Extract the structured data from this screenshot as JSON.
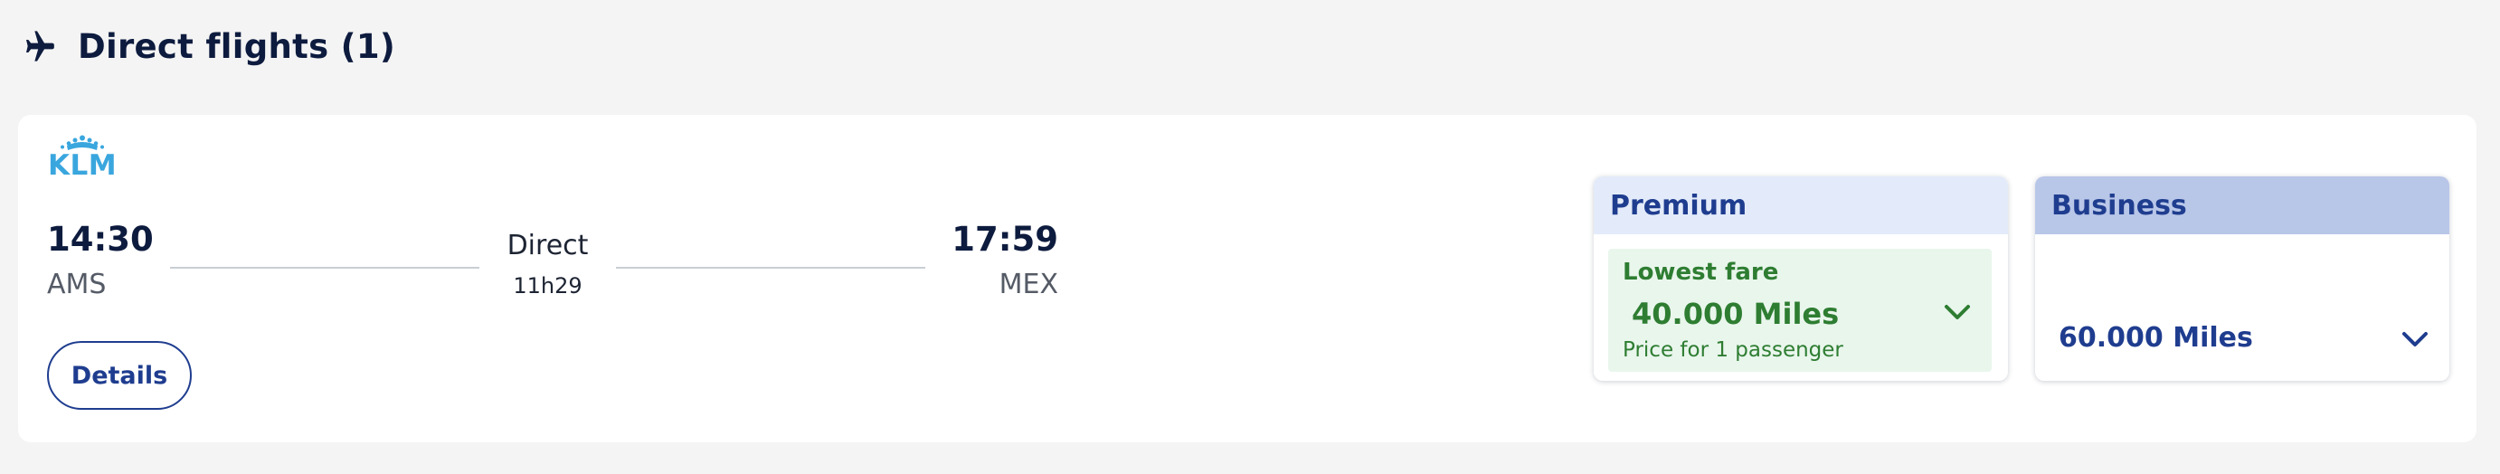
{
  "section": {
    "title": "Direct flights (1)",
    "icon": "airplane-icon"
  },
  "flight": {
    "airline_logo_text": "KLM",
    "departure": {
      "time": "14:30",
      "airport": "AMS"
    },
    "arrival": {
      "time": "17:59",
      "airport": "MEX"
    },
    "stops": "Direct",
    "duration": "11h29",
    "details_label": "Details"
  },
  "fares": {
    "premium": {
      "label": "Premium",
      "badge": "Lowest fare",
      "price": "40.000 Miles",
      "note": "Price for 1 passenger",
      "icon": "chevron-down-icon"
    },
    "business": {
      "label": "Business",
      "price": "60.000 Miles",
      "icon": "chevron-down-icon"
    }
  },
  "colors": {
    "navy": "#0d1b3e",
    "brand_blue": "#1f3d8f",
    "klm_blue": "#3aa6de",
    "lowest_fare_green": "#2e7d32",
    "lowest_fare_bg": "#e9f6ec",
    "premium_header_bg": "#e3ebfa",
    "business_header_bg": "#b8c6e8"
  }
}
